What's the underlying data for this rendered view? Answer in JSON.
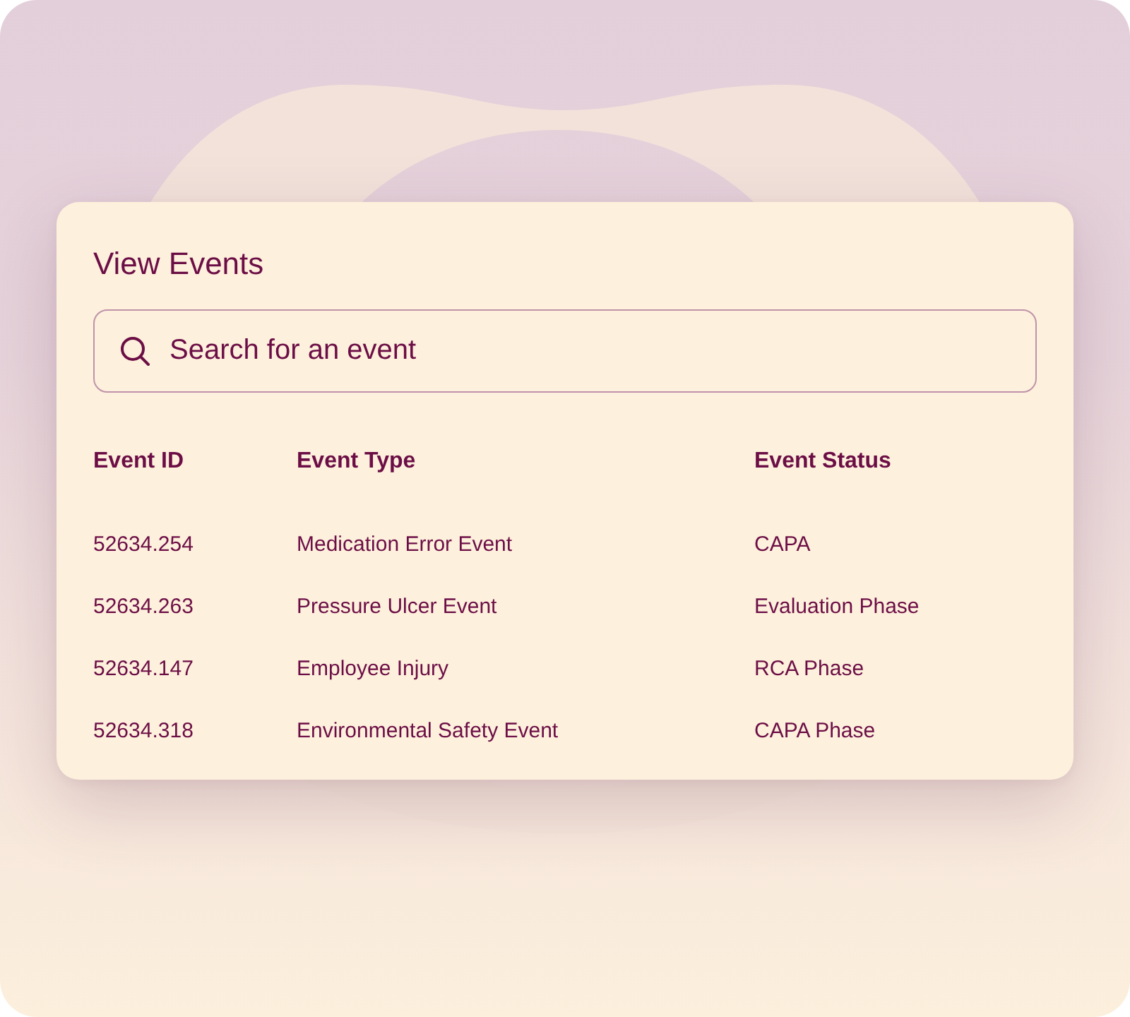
{
  "title": "View Events",
  "search": {
    "placeholder": "Search for an event"
  },
  "table": {
    "columns": [
      "Event ID",
      "Event Type",
      "Event Status"
    ],
    "rows": [
      [
        "52634.254",
        "Medication Error Event",
        "CAPA"
      ],
      [
        "52634.263",
        "Pressure Ulcer Event",
        "Evaluation Phase"
      ],
      [
        "52634.147",
        "Employee Injury",
        "RCA Phase"
      ],
      [
        "52634.318",
        "Environmental Safety Event",
        "CAPA Phase"
      ]
    ]
  }
}
